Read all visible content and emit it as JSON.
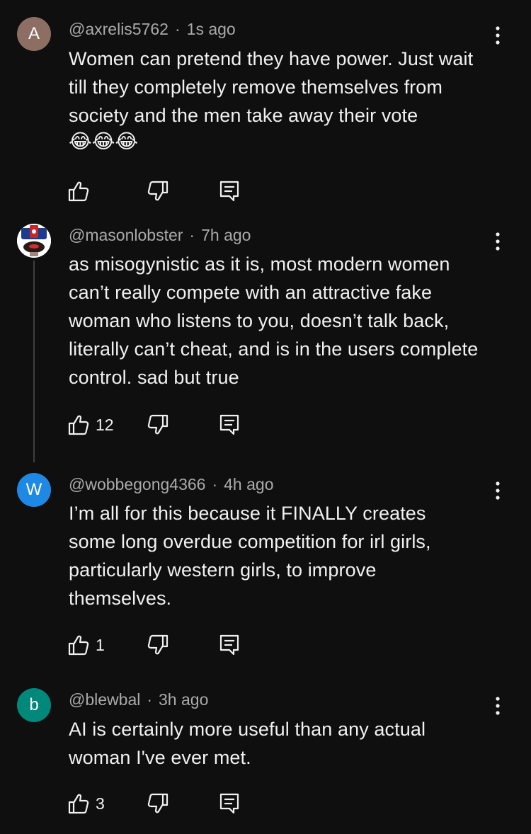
{
  "comments": [
    {
      "avatar_letter": "A",
      "avatar_color": "#8d6e63",
      "handle": "@axrelis5762",
      "time": "1s ago",
      "text": "Women can pretend they have power. Just wait till they completely remove themselves from society and the men take away their vote",
      "emoji": "😂😂😂",
      "likes": ""
    },
    {
      "avatar_letter": "",
      "avatar_color": "#ffffff",
      "handle": "@masonlobster",
      "time": "7h ago",
      "text": "as misogynistic as it is, most modern women can’t really compete with an attractive fake woman who listens to you, doesn’t talk back, literally can’t cheat, and is in the users complete control. sad but true",
      "likes": "12"
    },
    {
      "avatar_letter": "W",
      "avatar_color": "#1e88e5",
      "handle": "@wobbegong4366",
      "time": "4h ago",
      "text": "I’m all for this because it FINALLY creates some long overdue competition for irl girls, particularly western girls, to improve themselves.",
      "likes": "1"
    },
    {
      "avatar_letter": "b",
      "avatar_color": "#00897b",
      "handle": "@blewbal",
      "time": "3h ago",
      "text": "AI is certainly more useful than any actual woman I've ever met.",
      "likes": "3"
    }
  ],
  "icons": {
    "like": "thumb-up-icon",
    "dislike": "thumb-down-icon",
    "reply": "reply-icon",
    "menu": "more-vert-icon"
  }
}
